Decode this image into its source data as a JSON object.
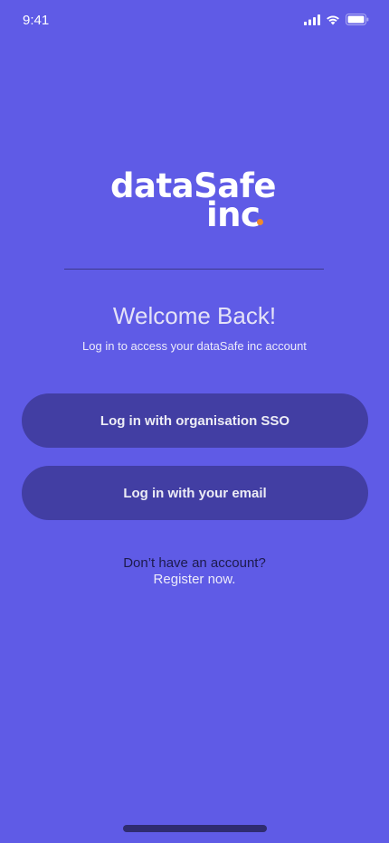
{
  "status_bar": {
    "time": "9:41"
  },
  "logo": {
    "line1": "dataSafe",
    "line2": "inc",
    "dot_color": "#f08a2c"
  },
  "welcome": {
    "title": "Welcome Back!",
    "subtitle": "Log in to access your dataSafe inc account"
  },
  "buttons": {
    "sso_label": "Log in with organisation SSO",
    "email_label": "Log in with your email"
  },
  "register": {
    "prompt": "Don’t have an account?",
    "link_label": "Register now."
  },
  "colors": {
    "background": "#5f5be6",
    "button": "#423ea3"
  }
}
